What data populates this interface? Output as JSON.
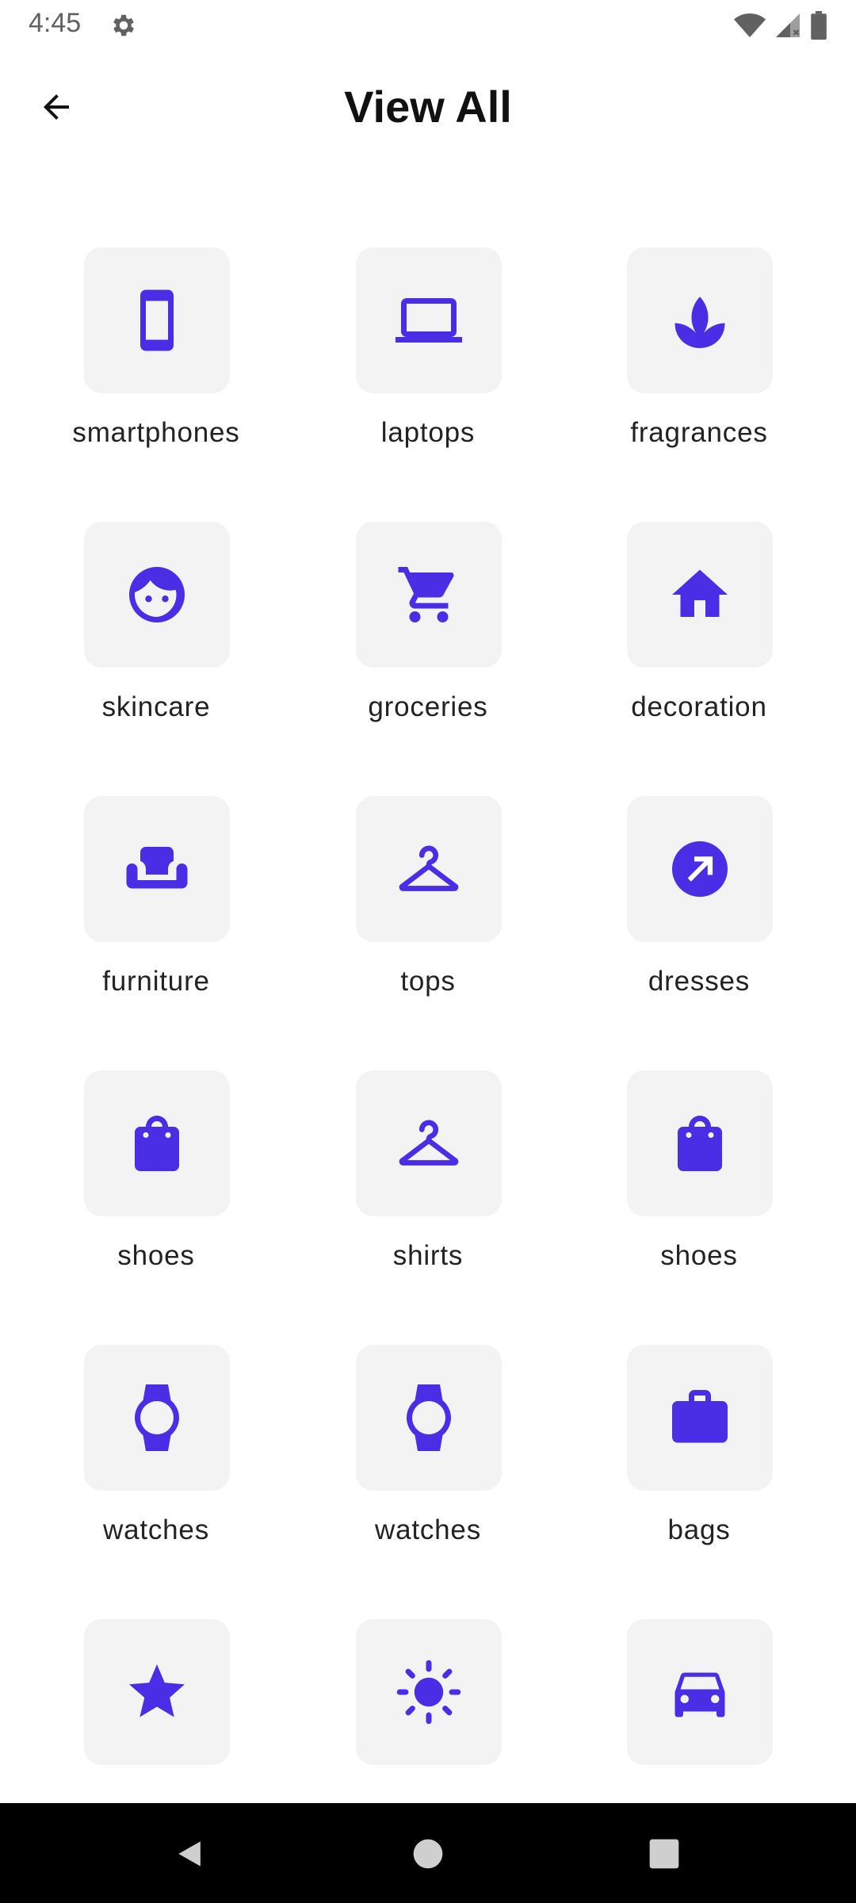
{
  "status_bar": {
    "time": "4:45",
    "icons": [
      "gear-icon",
      "wifi-icon",
      "signal-icon",
      "battery-icon"
    ]
  },
  "header": {
    "title": "View All",
    "back_icon": "arrow-back-icon"
  },
  "colors": {
    "accent": "#4a2ee6",
    "tile_background": "#f3f3f4",
    "nav_bar": "#000000"
  },
  "categories": [
    {
      "label": "smartphones",
      "icon": "smartphone-icon"
    },
    {
      "label": "laptops",
      "icon": "laptop-icon"
    },
    {
      "label": "fragrances",
      "icon": "spa-icon"
    },
    {
      "label": "skincare",
      "icon": "face-icon"
    },
    {
      "label": "groceries",
      "icon": "shopping-cart-icon"
    },
    {
      "label": "decoration",
      "icon": "home-icon"
    },
    {
      "label": "furniture",
      "icon": "sofa-icon"
    },
    {
      "label": "tops",
      "icon": "hanger-icon"
    },
    {
      "label": "dresses",
      "icon": "arrow-circle-icon"
    },
    {
      "label": "shoes",
      "icon": "shopping-bag-icon"
    },
    {
      "label": "shirts",
      "icon": "hanger-icon"
    },
    {
      "label": "shoes",
      "icon": "shopping-bag-icon"
    },
    {
      "label": "watches",
      "icon": "watch-icon"
    },
    {
      "label": "watches",
      "icon": "watch-icon"
    },
    {
      "label": "bags",
      "icon": "briefcase-icon"
    },
    {
      "label": "",
      "icon": "star-icon"
    },
    {
      "label": "",
      "icon": "sun-icon"
    },
    {
      "label": "",
      "icon": "car-icon"
    }
  ],
  "nav_bar": {
    "buttons": [
      "back-triangle-icon",
      "home-circle-icon",
      "recents-square-icon"
    ]
  }
}
